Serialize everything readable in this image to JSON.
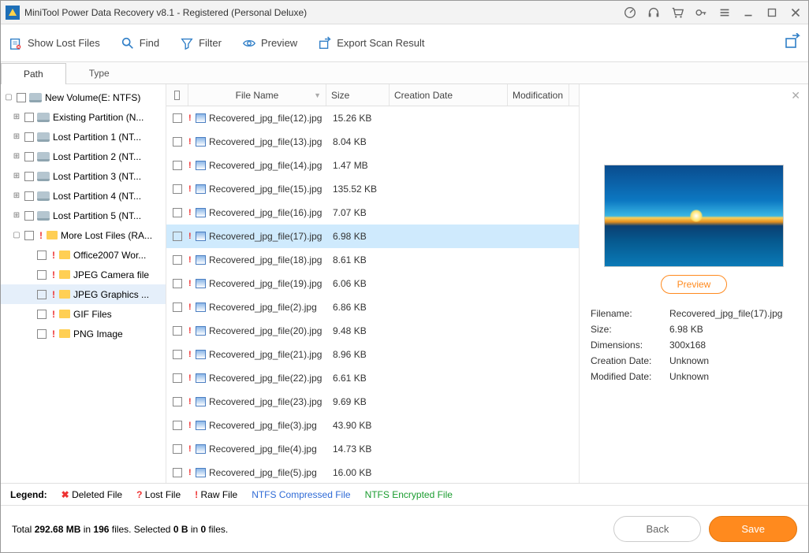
{
  "title": "MiniTool Power Data Recovery v8.1 - Registered (Personal Deluxe)",
  "toolbar": {
    "show_lost": "Show Lost Files",
    "find": "Find",
    "filter": "Filter",
    "preview": "Preview",
    "export": "Export Scan Result"
  },
  "tabs": {
    "path": "Path",
    "type": "Type"
  },
  "tree": {
    "root": "New Volume(E: NTFS)",
    "nodes": [
      "Existing Partition (N...",
      "Lost Partition 1 (NT...",
      "Lost Partition 2 (NT...",
      "Lost Partition 3 (NT...",
      "Lost Partition 4 (NT...",
      "Lost Partition 5 (NT..."
    ],
    "more_lost": "More Lost Files (RA...",
    "subfolders": [
      "Office2007 Wor...",
      "JPEG Camera file",
      "JPEG Graphics ...",
      "GIF Files",
      "PNG Image"
    ],
    "selected_subfolder": 2
  },
  "columns": {
    "name": "File Name",
    "size": "Size",
    "cd": "Creation Date",
    "md": "Modification"
  },
  "files": [
    {
      "name": "Recovered_jpg_file(12).jpg",
      "size": "15.26 KB"
    },
    {
      "name": "Recovered_jpg_file(13).jpg",
      "size": "8.04 KB"
    },
    {
      "name": "Recovered_jpg_file(14).jpg",
      "size": "1.47 MB"
    },
    {
      "name": "Recovered_jpg_file(15).jpg",
      "size": "135.52 KB"
    },
    {
      "name": "Recovered_jpg_file(16).jpg",
      "size": "7.07 KB"
    },
    {
      "name": "Recovered_jpg_file(17).jpg",
      "size": "6.98 KB",
      "selected": true
    },
    {
      "name": "Recovered_jpg_file(18).jpg",
      "size": "8.61 KB"
    },
    {
      "name": "Recovered_jpg_file(19).jpg",
      "size": "6.06 KB"
    },
    {
      "name": "Recovered_jpg_file(2).jpg",
      "size": "6.86 KB"
    },
    {
      "name": "Recovered_jpg_file(20).jpg",
      "size": "9.48 KB"
    },
    {
      "name": "Recovered_jpg_file(21).jpg",
      "size": "8.96 KB"
    },
    {
      "name": "Recovered_jpg_file(22).jpg",
      "size": "6.61 KB"
    },
    {
      "name": "Recovered_jpg_file(23).jpg",
      "size": "9.69 KB"
    },
    {
      "name": "Recovered_jpg_file(3).jpg",
      "size": "43.90 KB"
    },
    {
      "name": "Recovered_jpg_file(4).jpg",
      "size": "14.73 KB"
    },
    {
      "name": "Recovered_jpg_file(5).jpg",
      "size": "16.00 KB"
    }
  ],
  "preview": {
    "button": "Preview",
    "labels": {
      "fn": "Filename:",
      "sz": "Size:",
      "dim": "Dimensions:",
      "cd": "Creation Date:",
      "md": "Modified Date:"
    },
    "filename": "Recovered_jpg_file(17).jpg",
    "size": "6.98 KB",
    "dimensions": "300x168",
    "creation": "Unknown",
    "modified": "Unknown"
  },
  "legend": {
    "label": "Legend:",
    "deleted": "Deleted File",
    "lost": "Lost File",
    "raw": "Raw File",
    "ntfsc": "NTFS Compressed File",
    "ntfse": "NTFS Encrypted File"
  },
  "status": {
    "prefix": "Total ",
    "total_size": "292.68 MB",
    "mid1": " in ",
    "total_files": "196",
    "mid2": " files.  Selected ",
    "sel_b": "0 B",
    "mid3": " in ",
    "sel_n": "0",
    "suffix": " files."
  },
  "buttons": {
    "back": "Back",
    "save": "Save"
  }
}
